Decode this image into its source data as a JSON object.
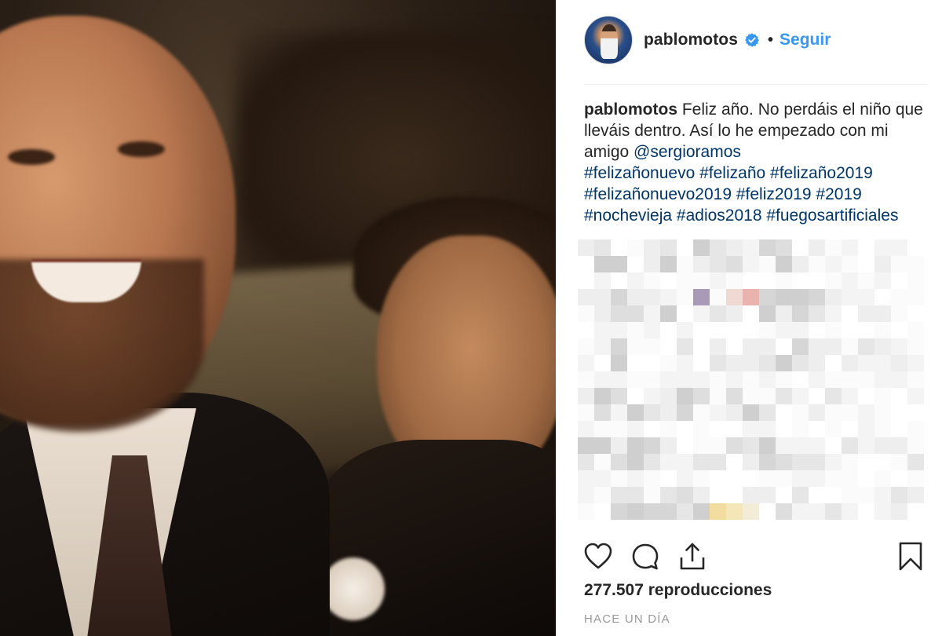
{
  "post": {
    "username": "pablomotos",
    "verified": true,
    "separator": "•",
    "follow_label": "Seguir",
    "caption": {
      "username": "pablomotos",
      "text": "Feliz año. No perdáis el niño que lleváis dentro. Así lo he empezado con mi amigo",
      "mention": "@sergioramos",
      "hashtags_line1": "#felizañonuevo #felizaño #felizaño2019",
      "hashtags_line2": "#felizañonuevo2019 #feliz2019 #2019",
      "hashtags_line3": "#nochevieja #adios2018 #fuegosartificiales"
    },
    "views": "277.507 reproducciones",
    "timestamp": "HACE UN DÍA"
  },
  "icons": {
    "like": "heart-icon",
    "comment": "comment-bubble-icon",
    "share": "share-upload-icon",
    "save": "bookmark-icon",
    "verified": "verified-badge-icon"
  },
  "colors": {
    "link_blue": "#3897f0",
    "verified_blue": "#3897f0",
    "hashtag_link": "#003569",
    "text_primary": "#262626",
    "text_secondary": "#999999",
    "divider": "#efefef"
  }
}
